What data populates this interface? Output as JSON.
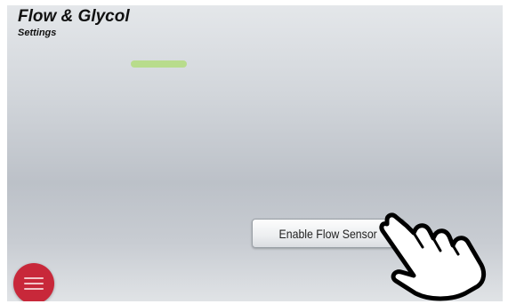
{
  "header": {
    "title": "Flow & Glycol",
    "subtitle": "Settings"
  },
  "main": {
    "enable_flow_sensor_label": "Enable Flow Sensor"
  },
  "icons": {
    "menu": "hamburger-menu-icon",
    "pointer": "hand-pointer-icon"
  },
  "colors": {
    "menu_button": "#c8283a",
    "indicator": "#b5dc83"
  }
}
